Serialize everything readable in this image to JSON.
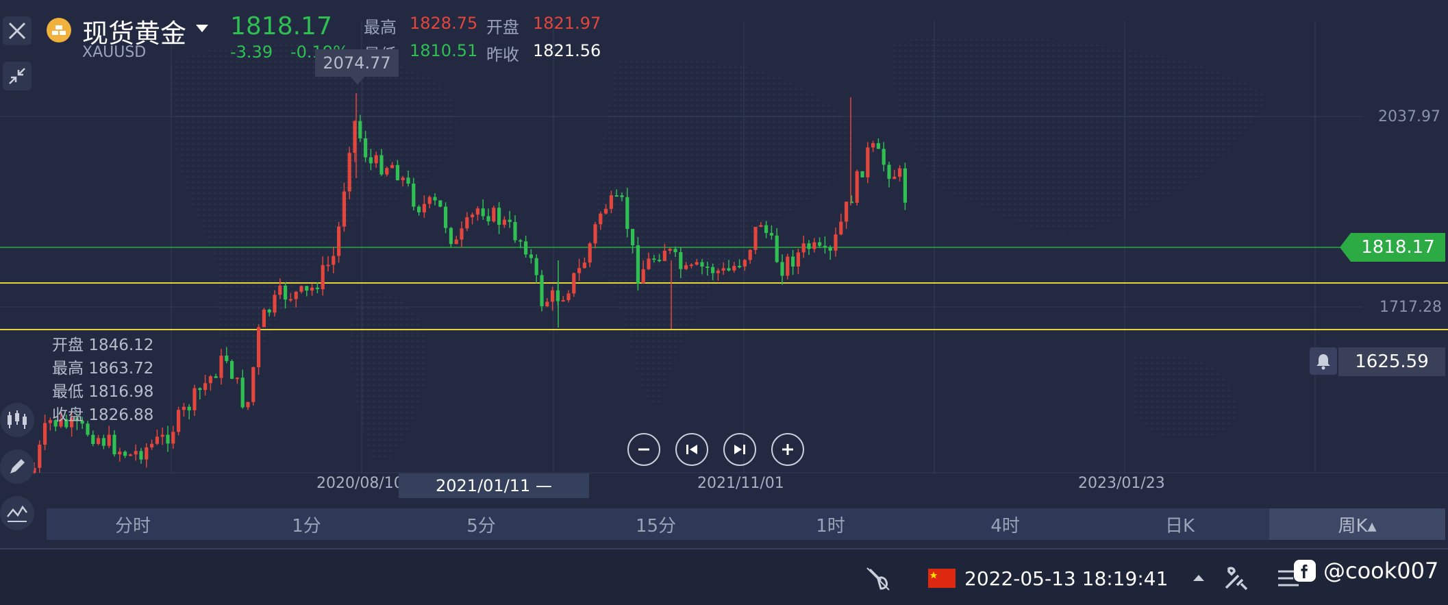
{
  "header": {
    "name": "现货黄金",
    "code": "XAUUSD",
    "price": "1818.17",
    "change": "-3.39",
    "change_pct": "-0.19%",
    "high_label": "最高",
    "high_value": "1828.75",
    "open_label": "开盘",
    "open_value": "1821.97",
    "low_label": "最低",
    "low_value": "1810.51",
    "prev_label": "昨收",
    "prev_value": "1821.56"
  },
  "chart": {
    "hover_price": "2074.77",
    "y_tick_high": "2037.97",
    "y_tick_low": "1717.28",
    "current_price_tag": "1818.17",
    "alert_price": "1625.59",
    "ohlc": {
      "open_label": "开盘",
      "open": "1846.12",
      "high_label": "最高",
      "high": "1863.72",
      "low_label": "最低",
      "low": "1816.98",
      "close_label": "收盘",
      "close": "1826.88"
    },
    "dates": [
      "2020/08/10",
      "2021/11/01",
      "2023/01/23"
    ],
    "selected_date": "2021/01/11 —",
    "colors": {
      "up": "#e2463c",
      "down": "#2fbf52",
      "support": "#e6d43a"
    }
  },
  "tabs": [
    {
      "label": "分时"
    },
    {
      "label": "1分"
    },
    {
      "label": "5分"
    },
    {
      "label": "15分"
    },
    {
      "label": "1时"
    },
    {
      "label": "4时"
    },
    {
      "label": "日K"
    },
    {
      "label": "周K▴"
    }
  ],
  "status": {
    "datetime": "2022-05-13 18:19:41",
    "watermark": "@cook007"
  },
  "icons": [
    "close-icon",
    "collapse-icon",
    "indicator-icon",
    "pencil-icon",
    "line-chart-icon",
    "bell-icon",
    "zoom-out-icon",
    "prev-icon",
    "next-icon",
    "zoom-in-icon",
    "satellite-icon",
    "china-flag",
    "tools-icon",
    "list-icon",
    "facebook-icon"
  ]
}
